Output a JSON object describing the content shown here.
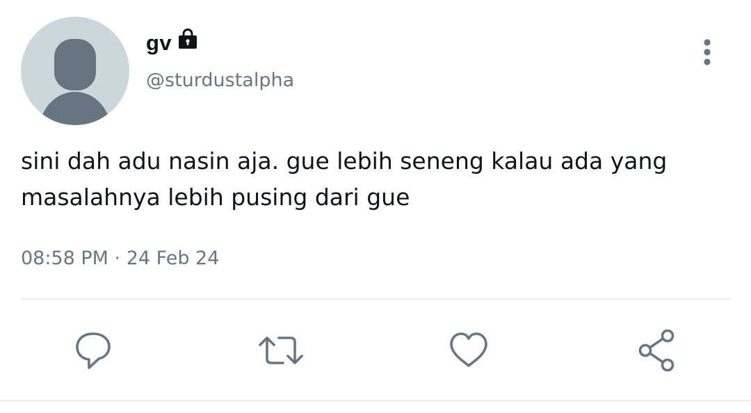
{
  "tweet": {
    "display_name": "gv",
    "handle": "@sturdustalpha",
    "text": "sini dah adu nasin aja. gue lebih seneng kalau ada yang\nmasalahnya lebih pusing dari gue",
    "timestamp": "08:58 PM · 24 Feb 24"
  },
  "icons": {
    "lock": "lock-icon",
    "more": "more-vertical-icon",
    "reply": "reply-icon",
    "retweet": "retweet-icon",
    "like": "heart-icon",
    "share": "share-icon"
  },
  "colors": {
    "avatar_bg": "#ccd6dd",
    "avatar_fg": "#66757f",
    "secondary_text": "#687684",
    "icon": "#687684",
    "divider": "#e6ecf0"
  }
}
